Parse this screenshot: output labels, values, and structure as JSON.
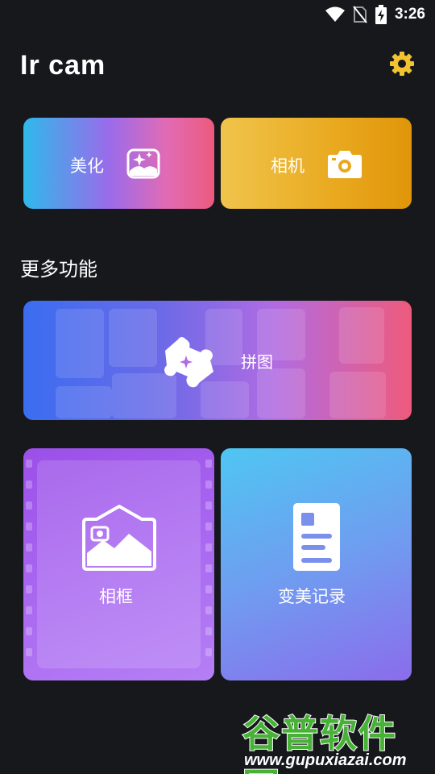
{
  "status_bar": {
    "time": "3:26",
    "icons": [
      "wifi-icon",
      "no-sim-icon",
      "battery-charging-icon"
    ]
  },
  "header": {
    "app_title": "Ir cam",
    "settings_icon": "gear-icon"
  },
  "top_cards": [
    {
      "label": "美化",
      "icon": "image-sparkle-icon"
    },
    {
      "label": "相机",
      "icon": "camera-icon"
    }
  ],
  "more_section": {
    "title": "更多功能"
  },
  "collage_card": {
    "label": "拼图",
    "icon": "puzzle-icon"
  },
  "bottom_cards": [
    {
      "label": "相框",
      "icon": "picture-frame-icon"
    },
    {
      "label": "变美记录",
      "icon": "document-icon"
    }
  ],
  "watermark": {
    "title": "谷普软件园",
    "url": "www.gupuxiazai.com"
  },
  "colors": {
    "background": "#16181c",
    "settings_icon": "#f2c230",
    "watermark_green": "#47b236"
  }
}
